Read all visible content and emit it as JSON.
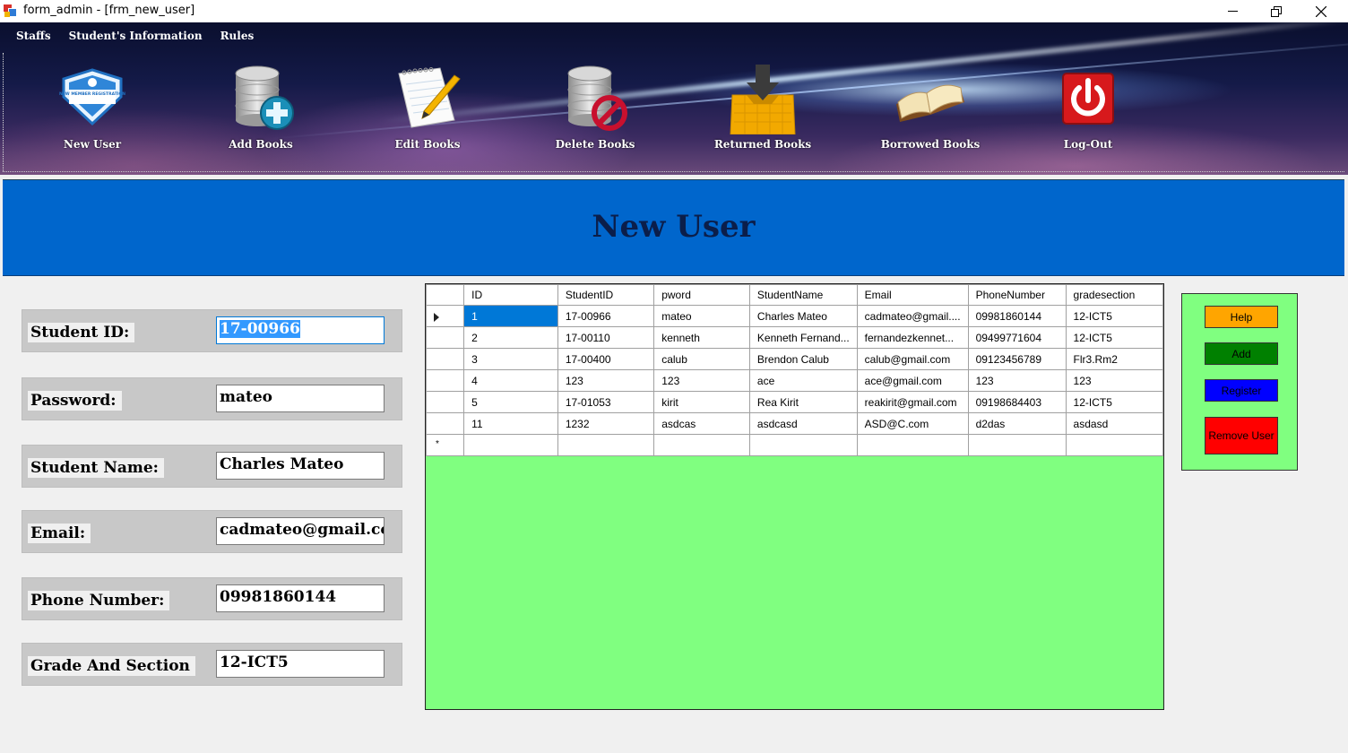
{
  "window": {
    "title": "form_admin - [frm_new_user]"
  },
  "menu": [
    "Staffs",
    "Student's Information",
    "Rules"
  ],
  "toolbar": [
    {
      "label": "New User",
      "icon": "new-member-badge-icon"
    },
    {
      "label": "Add Books",
      "icon": "database-add-icon"
    },
    {
      "label": "Edit Books",
      "icon": "notepad-pencil-icon"
    },
    {
      "label": "Delete Books",
      "icon": "database-delete-icon"
    },
    {
      "label": "Returned Books",
      "icon": "inbox-download-icon"
    },
    {
      "label": "Borrowed Books",
      "icon": "open-book-icon"
    },
    {
      "label": "Log-Out",
      "icon": "power-icon"
    }
  ],
  "badge_text": "NEW MEMBER REGISTRATION",
  "header": {
    "title": "New User"
  },
  "form": {
    "fields": [
      {
        "label": "Student ID:",
        "value": "17-00966"
      },
      {
        "label": "Password:",
        "value": "mateo"
      },
      {
        "label": "Student Name:",
        "value": "Charles Mateo"
      },
      {
        "label": "Email:",
        "value": "cadmateo@gmail.co"
      },
      {
        "label": "Phone Number:",
        "value": "09981860144"
      },
      {
        "label": "Grade And Section",
        "value": "12-ICT5"
      }
    ]
  },
  "grid": {
    "columns": [
      "ID",
      "StudentID",
      "pword",
      "StudentName",
      "Email",
      "PhoneNumber",
      "gradesection"
    ],
    "rows": [
      [
        "1",
        "17-00966",
        "mateo",
        "Charles Mateo",
        "cadmateo@gmail....",
        "09981860144",
        "12-ICT5"
      ],
      [
        "2",
        "17-00110",
        "kenneth",
        "Kenneth Fernand...",
        "fernandezkennet...",
        "09499771604",
        "12-ICT5"
      ],
      [
        "3",
        "17-00400",
        "calub",
        "Brendon Calub",
        "calub@gmail.com",
        "09123456789",
        "Flr3.Rm2"
      ],
      [
        "4",
        "123",
        "123",
        "ace",
        "ace@gmail.com",
        "123",
        "123"
      ],
      [
        "5",
        "17-01053",
        "kirit",
        "Rea Kirit",
        "reakirit@gmail.com",
        "09198684403",
        "12-ICT5"
      ],
      [
        "11",
        "1232",
        "asdcas",
        "asdcasd",
        "ASD@C.com",
        "d2das",
        "asdasd"
      ]
    ],
    "new_row_marker": "*"
  },
  "buttons": {
    "help": "Help",
    "add": "Add",
    "register": "Register",
    "remove": "Remove User"
  },
  "colors": {
    "header_bg": "#0066cc",
    "grid_bg": "#80ff80",
    "help": "#ffa500",
    "add": "#008000",
    "register": "#0000ff",
    "remove": "#ff0000"
  }
}
